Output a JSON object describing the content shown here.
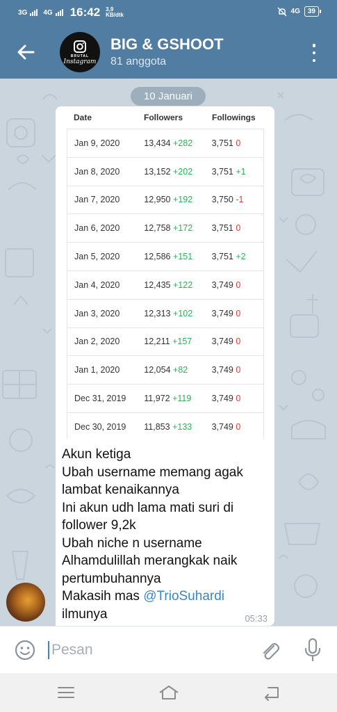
{
  "status_bar": {
    "net1": "3G",
    "net2": "4G",
    "time": "16:42",
    "speed_value": "3,9",
    "speed_unit": "KB/dtk",
    "net_right": "4G",
    "battery": "39"
  },
  "header": {
    "title": "BIG & GSHOOT",
    "subtitle": "81 anggota",
    "avatar_text1": "BRUTAL",
    "avatar_text2": "Instagram"
  },
  "chat": {
    "date_chip": "10 Januari",
    "table": {
      "headers": [
        "Date",
        "Followers",
        "Followings"
      ],
      "rows": [
        {
          "date": "Jan 9, 2020",
          "followers": "13,434",
          "followers_change": "+282",
          "followings": "3,751",
          "followings_change": "0"
        },
        {
          "date": "Jan 8, 2020",
          "followers": "13,152",
          "followers_change": "+202",
          "followings": "3,751",
          "followings_change": "+1"
        },
        {
          "date": "Jan 7, 2020",
          "followers": "12,950",
          "followers_change": "+192",
          "followings": "3,750",
          "followings_change": "-1"
        },
        {
          "date": "Jan 6, 2020",
          "followers": "12,758",
          "followers_change": "+172",
          "followings": "3,751",
          "followings_change": "0"
        },
        {
          "date": "Jan 5, 2020",
          "followers": "12,586",
          "followers_change": "+151",
          "followings": "3,751",
          "followings_change": "+2"
        },
        {
          "date": "Jan 4, 2020",
          "followers": "12,435",
          "followers_change": "+122",
          "followings": "3,749",
          "followings_change": "0"
        },
        {
          "date": "Jan 3, 2020",
          "followers": "12,313",
          "followers_change": "+102",
          "followings": "3,749",
          "followings_change": "0"
        },
        {
          "date": "Jan 2, 2020",
          "followers": "12,211",
          "followers_change": "+157",
          "followings": "3,749",
          "followings_change": "0"
        },
        {
          "date": "Jan 1, 2020",
          "followers": "12,054",
          "followers_change": "+82",
          "followings": "3,749",
          "followings_change": "0"
        },
        {
          "date": "Dec 31, 2019",
          "followers": "11,972",
          "followers_change": "+119",
          "followings": "3,749",
          "followings_change": "0"
        },
        {
          "date": "Dec 30, 2019",
          "followers": "11,853",
          "followers_change": "+133",
          "followings": "3,749",
          "followings_change": "0"
        }
      ]
    },
    "message": {
      "lines": [
        "Akun ketiga",
        "Ubah username memang agak lambat kenaikannya",
        "Ini akun udh lama mati suri di follower 9,2k",
        "Ubah niche n username",
        "Alhamdulillah merangkak naik pertumbuhannya"
      ],
      "thanks_prefix": "Makasih mas ",
      "mention": "@TrioSuhardi",
      "thanks_suffix": "ilmunya",
      "time": "05:33"
    }
  },
  "input": {
    "placeholder": "Pesan"
  },
  "colors": {
    "header_bg": "#517da2",
    "chat_bg": "#cbd5de",
    "positive": "#2bb354",
    "negative": "#e53935",
    "mention": "#3d84c6"
  }
}
